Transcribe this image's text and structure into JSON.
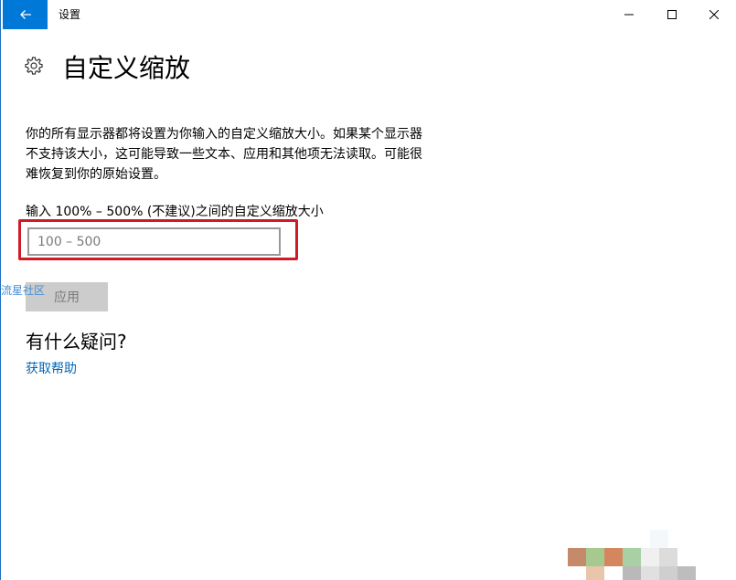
{
  "window": {
    "title": "设置",
    "back_icon": "arrow-left-icon",
    "minimize_icon": "minimize-icon",
    "maximize_icon": "maximize-icon",
    "close_icon": "close-icon",
    "accent": "#0078d7"
  },
  "page": {
    "icon": "gear-icon",
    "title": "自定义缩放",
    "description": "你的所有显示器都将设置为你输入的自定义缩放大小。如果某个显示器不支持该大小，这可能导致一些文本、应用和其他项无法读取。可能很难恢复到你的原始设置。"
  },
  "scale_input": {
    "label": "输入 100% – 500% (不建议)之间的自定义缩放大小",
    "placeholder": "100 – 500",
    "value": "",
    "highlight_color": "#d01b26"
  },
  "apply_button": {
    "label": "应用",
    "enabled": false
  },
  "help": {
    "heading": "有什么疑问?",
    "link": "获取帮助",
    "link_color": "#0067b8"
  },
  "watermark": {
    "text": "流星社区"
  }
}
